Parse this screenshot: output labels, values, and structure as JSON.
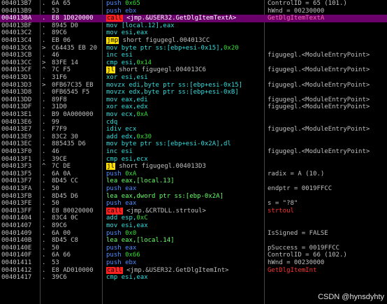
{
  "rows": [
    {
      "addr": "004013B7",
      "arrow": ".",
      "hex": "6A 65",
      "dis": [
        {
          "t": "push ",
          "c": "kw-push"
        },
        {
          "t": "0x65",
          "c": "num"
        }
      ],
      "cmt": "ControlID = 65 (101.)"
    },
    {
      "addr": "004013B9",
      "arrow": ".",
      "hex": "53",
      "dis": [
        {
          "t": "push ",
          "c": "kw-push"
        },
        {
          "t": "ebx",
          "c": "kw-push"
        }
      ],
      "cmt": "hWnd = 00230000"
    },
    {
      "addr": "004013BA",
      "arrow": ".",
      "hex": "E8 1D020000",
      "dis": [
        {
          "t": "call",
          "c": "hl-call"
        },
        {
          "t": " <jmp.&USER32.GetDlgItemTextA>",
          "c": ""
        }
      ],
      "cmt": "GetDlgItemTextA",
      "sel": true,
      "cmtClass": "cmt-red"
    },
    {
      "addr": "004013BF",
      "arrow": ".",
      "hex": "8945 D0",
      "dis": [
        {
          "t": "mov ",
          "c": "kw-mov"
        },
        {
          "t": "[local.12],eax",
          "c": "kw-mov"
        }
      ],
      "cmt": ""
    },
    {
      "addr": "004013C2",
      "arrow": ".",
      "hex": "89C6",
      "dis": [
        {
          "t": "mov ",
          "c": "kw-mov"
        },
        {
          "t": "esi,eax",
          "c": "kw-mov"
        }
      ],
      "cmt": ""
    },
    {
      "addr": "004013C4",
      "arrow": ".",
      "hex": "EB 06",
      "dis": [
        {
          "t": "jmp",
          "c": "hl-jmp"
        },
        {
          "t": " short figugegl.004013CC",
          "c": ""
        }
      ],
      "cmt": ""
    },
    {
      "addr": "004013C6",
      "arrow": ">",
      "hex": "C64435 EB 20",
      "dis": [
        {
          "t": "mov ",
          "c": "kw-mov"
        },
        {
          "t": "byte ptr ss:[ebp+esi-0x15],",
          "c": "kw-mov"
        },
        {
          "t": "0x20",
          "c": "num"
        }
      ],
      "cmt": ""
    },
    {
      "addr": "004013CB",
      "arrow": ".",
      "hex": "46",
      "dis": [
        {
          "t": "inc ",
          "c": "kw-cyan"
        },
        {
          "t": "esi",
          "c": "kw-cyan"
        }
      ],
      "cmt": "figugegl.<ModuleEntryPoint>"
    },
    {
      "addr": "004013CC",
      "arrow": ">",
      "hex": "83FE 14",
      "dis": [
        {
          "t": "cmp ",
          "c": "kw-cyan"
        },
        {
          "t": "esi,",
          "c": "kw-cyan"
        },
        {
          "t": "0x14",
          "c": "num"
        }
      ],
      "cmt": ""
    },
    {
      "addr": "004013CF",
      "arrow": "^",
      "hex": "7C F5",
      "dis": [
        {
          "t": "jl",
          "c": "hl-jmp"
        },
        {
          "t": " short figugegl.004013C6",
          "c": ""
        }
      ],
      "cmt": "figugegl.<ModuleEntryPoint>"
    },
    {
      "addr": "004013D1",
      "arrow": ".",
      "hex": "31F6",
      "dis": [
        {
          "t": "xor ",
          "c": "kw-cyan"
        },
        {
          "t": "esi,esi",
          "c": "kw-cyan"
        }
      ],
      "cmt": ""
    },
    {
      "addr": "004013D3",
      "arrow": ">",
      "hex": "0FB67C35 EB",
      "dis": [
        {
          "t": "movzx ",
          "c": "kw-mov"
        },
        {
          "t": "edi,byte ptr ss:[ebp+esi-0x15]",
          "c": "kw-mov"
        }
      ],
      "cmt": "figugegl.<ModuleEntryPoint>"
    },
    {
      "addr": "004013D8",
      "arrow": ".",
      "hex": "0FB6545 F5",
      "dis": [
        {
          "t": "movzx ",
          "c": "kw-mov"
        },
        {
          "t": "edx,byte ptr ss:[ebp+esi-0xB]",
          "c": "kw-mov"
        }
      ],
      "cmt": ""
    },
    {
      "addr": "004013DD",
      "arrow": ".",
      "hex": "89F8",
      "dis": [
        {
          "t": "mov ",
          "c": "kw-mov"
        },
        {
          "t": "eax,edi",
          "c": "kw-mov"
        }
      ],
      "cmt": "figugegl.<ModuleEntryPoint>"
    },
    {
      "addr": "004013DF",
      "arrow": ".",
      "hex": "31D0",
      "dis": [
        {
          "t": "xor ",
          "c": "kw-cyan"
        },
        {
          "t": "eax,edx",
          "c": "kw-cyan"
        }
      ],
      "cmt": "figugegl.<ModuleEntryPoint>"
    },
    {
      "addr": "004013E1",
      "arrow": ".",
      "hex": "B9 0A000000",
      "dis": [
        {
          "t": "mov ",
          "c": "kw-mov"
        },
        {
          "t": "ecx,",
          "c": "kw-mov"
        },
        {
          "t": "0xA",
          "c": "num"
        }
      ],
      "cmt": ""
    },
    {
      "addr": "004013E6",
      "arrow": ".",
      "hex": "99",
      "dis": [
        {
          "t": "cdq",
          "c": "kw-cyan"
        }
      ],
      "cmt": ""
    },
    {
      "addr": "004013E7",
      "arrow": ".",
      "hex": "F7F9",
      "dis": [
        {
          "t": "idiv ",
          "c": "kw-cyan"
        },
        {
          "t": "ecx",
          "c": "kw-cyan"
        }
      ],
      "cmt": "figugegl.<ModuleEntryPoint>"
    },
    {
      "addr": "004013E9",
      "arrow": ".",
      "hex": "83C2 30",
      "dis": [
        {
          "t": "add ",
          "c": "kw-cyan"
        },
        {
          "t": "edx,",
          "c": "kw-cyan"
        },
        {
          "t": "0x30",
          "c": "num"
        }
      ],
      "cmt": ""
    },
    {
      "addr": "004013EC",
      "arrow": ".",
      "hex": "885435 D6",
      "dis": [
        {
          "t": "mov ",
          "c": "kw-mov"
        },
        {
          "t": "byte ptr ss:[ebp+esi-0x2A],dl",
          "c": "kw-mov"
        }
      ],
      "cmt": ""
    },
    {
      "addr": "004013F0",
      "arrow": ".",
      "hex": "46",
      "dis": [
        {
          "t": "inc ",
          "c": "kw-cyan"
        },
        {
          "t": "esi",
          "c": "kw-cyan"
        }
      ],
      "cmt": "figugegl.<ModuleEntryPoint>"
    },
    {
      "addr": "004013F1",
      "arrow": ".",
      "hex": "39CE",
      "dis": [
        {
          "t": "cmp ",
          "c": "kw-cyan"
        },
        {
          "t": "esi,ecx",
          "c": "kw-cyan"
        }
      ],
      "cmt": ""
    },
    {
      "addr": "004013F3",
      "arrow": "^",
      "hex": "7C DE",
      "dis": [
        {
          "t": "jl",
          "c": "hl-jmp"
        },
        {
          "t": " short figugegl.004013D3",
          "c": ""
        }
      ],
      "cmt": ""
    },
    {
      "addr": "004013F5",
      "arrow": ".",
      "hex": "6A 0A",
      "dis": [
        {
          "t": "push ",
          "c": "kw-push"
        },
        {
          "t": "0xA",
          "c": "num"
        }
      ],
      "cmt": "radix = A (10.)"
    },
    {
      "addr": "004013F7",
      "arrow": ".",
      "hex": "8D45 CC",
      "dis": [
        {
          "t": "lea ",
          "c": "kw-green"
        },
        {
          "t": "eax,[local.13]",
          "c": "kw-green"
        }
      ],
      "cmt": ""
    },
    {
      "addr": "004013FA",
      "arrow": ".",
      "hex": "50",
      "dis": [
        {
          "t": "push ",
          "c": "kw-push"
        },
        {
          "t": "eax",
          "c": "kw-push"
        }
      ],
      "cmt": "endptr = 0019FFCC"
    },
    {
      "addr": "004013FB",
      "arrow": ".",
      "hex": "8D45 D6",
      "dis": [
        {
          "t": "lea ",
          "c": "kw-green"
        },
        {
          "t": "eax,dword ptr ss:[ebp-0x2A]",
          "c": "kw-green"
        }
      ],
      "cmt": ""
    },
    {
      "addr": "004013FE",
      "arrow": ".",
      "hex": "50",
      "dis": [
        {
          "t": "push ",
          "c": "kw-push"
        },
        {
          "t": "eax",
          "c": "kw-push"
        }
      ],
      "cmt": "s = \"?8\""
    },
    {
      "addr": "004013FF",
      "arrow": ".",
      "hex": "E8 80020000",
      "dis": [
        {
          "t": "call",
          "c": "hl-call"
        },
        {
          "t": " <jmp.&CRTDLL.strtoul>",
          "c": ""
        }
      ],
      "cmt": "strtoul",
      "cmtClass": "cmt-red"
    },
    {
      "addr": "00401404",
      "arrow": ".",
      "hex": "83C4 0C",
      "dis": [
        {
          "t": "add ",
          "c": "kw-cyan"
        },
        {
          "t": "esp,",
          "c": "kw-cyan"
        },
        {
          "t": "0xC",
          "c": "num"
        }
      ],
      "cmt": ""
    },
    {
      "addr": "00401407",
      "arrow": ".",
      "hex": "89C6",
      "dis": [
        {
          "t": "mov ",
          "c": "kw-mov"
        },
        {
          "t": "esi,eax",
          "c": "kw-mov"
        }
      ],
      "cmt": ""
    },
    {
      "addr": "00401409",
      "arrow": ".",
      "hex": "6A 00",
      "dis": [
        {
          "t": "push ",
          "c": "kw-push"
        },
        {
          "t": "0x0",
          "c": "num"
        }
      ],
      "cmt": "IsSigned = FALSE"
    },
    {
      "addr": "0040140B",
      "arrow": ".",
      "hex": "8D45 C8",
      "dis": [
        {
          "t": "lea ",
          "c": "kw-green"
        },
        {
          "t": "eax,[local.14]",
          "c": "kw-green"
        }
      ],
      "cmt": ""
    },
    {
      "addr": "0040140E",
      "arrow": ".",
      "hex": "50",
      "dis": [
        {
          "t": "push ",
          "c": "kw-push"
        },
        {
          "t": "eax",
          "c": "kw-push"
        }
      ],
      "cmt": "pSuccess = 0019FFCC"
    },
    {
      "addr": "0040140F",
      "arrow": ".",
      "hex": "6A 66",
      "dis": [
        {
          "t": "push ",
          "c": "kw-push"
        },
        {
          "t": "0x66",
          "c": "num"
        }
      ],
      "cmt": "ControlID = 66 (102.)"
    },
    {
      "addr": "00401411",
      "arrow": ".",
      "hex": "53",
      "dis": [
        {
          "t": "push ",
          "c": "kw-push"
        },
        {
          "t": "ebx",
          "c": "kw-push"
        }
      ],
      "cmt": "hWnd = 00230000"
    },
    {
      "addr": "00401412",
      "arrow": ".",
      "hex": "E8 AD010000",
      "dis": [
        {
          "t": "call",
          "c": "hl-call"
        },
        {
          "t": " <jmp.&USER32.GetDlgItemInt>",
          "c": ""
        }
      ],
      "cmt": "GetDlgItemInt",
      "cmtClass": "cmt-red"
    },
    {
      "addr": "00401417",
      "arrow": ".",
      "hex": "39C6",
      "dis": [
        {
          "t": "cmp ",
          "c": "kw-cyan"
        },
        {
          "t": "esi,eax",
          "c": "kw-cyan"
        }
      ],
      "cmt": ""
    }
  ],
  "watermark": "CSDN @hynsdyhty"
}
